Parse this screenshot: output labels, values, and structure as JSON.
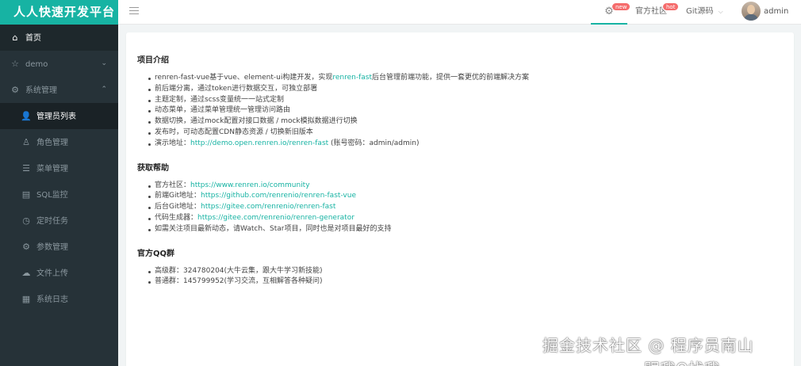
{
  "brand": {
    "title": "人人快速开发平台",
    "color": "#17b3a3"
  },
  "header": {
    "badge_new": "new",
    "community_label": "官方社区",
    "badge_hot": "hot",
    "git_label": "Git源码",
    "username": "admin"
  },
  "sidebar": {
    "items": [
      {
        "icon": "home-icon",
        "label": "首页"
      },
      {
        "icon": "star-icon",
        "label": "demo"
      },
      {
        "icon": "settings-icon",
        "label": "系统管理"
      }
    ],
    "sub_items": [
      {
        "icon": "user-icon",
        "label": "管理员列表"
      },
      {
        "icon": "role-icon",
        "label": "角色管理"
      },
      {
        "icon": "menu-icon",
        "label": "菜单管理"
      },
      {
        "icon": "sql-icon",
        "label": "SQL监控"
      },
      {
        "icon": "clock-icon",
        "label": "定时任务"
      },
      {
        "icon": "param-icon",
        "label": "参数管理"
      },
      {
        "icon": "upload-icon",
        "label": "文件上传"
      },
      {
        "icon": "log-icon",
        "label": "系统日志"
      }
    ]
  },
  "intro": {
    "title": "项目介绍",
    "item1_pre": "renren-fast-vue基于vue、element-ui构建开发，实现",
    "item1_link": "renren-fast",
    "item1_post": "后台管理前端功能，提供一套更优的前端解决方案",
    "item2": "前后端分离，通过token进行数据交互，可独立部署",
    "item3": "主题定制，通过scss变量统一一站式定制",
    "item4": "动态菜单，通过菜单管理统一管理访问路由",
    "item5": "数据切换，通过mock配置对接口数据 / mock模拟数据进行切换",
    "item6": "发布时，可动态配置CDN静态资源 / 切换新旧版本",
    "item7_pre": "演示地址：",
    "item7_link": "http://demo.open.renren.io/renren-fast",
    "item7_post": " (账号密码：admin/admin)"
  },
  "help": {
    "title": "获取帮助",
    "items": [
      {
        "pre": "官方社区：",
        "link": "https://www.renren.io/community"
      },
      {
        "pre": "前端Git地址：",
        "link": "https://github.com/renrenio/renren-fast-vue"
      },
      {
        "pre": "后台Git地址：",
        "link": "https://gitee.com/renrenio/renren-fast"
      },
      {
        "pre": "代码生成器：",
        "link": "https://gitee.com/renrenio/renren-generator"
      }
    ],
    "last": "如需关注项目最新动态，请Watch、Star项目，同时也是对项目最好的支持"
  },
  "qq": {
    "title": "官方QQ群",
    "items": [
      "高级群：324780204(大牛云集，跟大牛学习新技能)",
      "普通群：145799952(学习交流，互相解答各种疑问)"
    ]
  },
  "watermark": {
    "line1": "掘金技术社区 @ 程序员南山",
    "line2": "跟我Q找我"
  }
}
